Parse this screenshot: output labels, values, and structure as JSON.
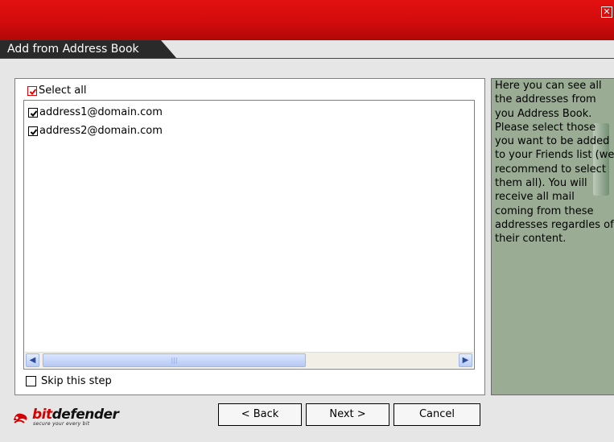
{
  "window": {
    "close_glyph": "✕"
  },
  "header": {
    "title": "Add from Address Book"
  },
  "select_all": {
    "label": "Select all",
    "checked": true
  },
  "address_list": [
    {
      "email": "address1@domain.com",
      "checked": true
    },
    {
      "email": "address2@domain.com",
      "checked": true
    }
  ],
  "scrollbar": {
    "left_arrow": "◀",
    "right_arrow": "▶",
    "thumb_grip": "|||"
  },
  "skip": {
    "label": "Skip this step",
    "checked": false
  },
  "help": {
    "text": "Here you can see all the addresses from you Address Book. Please select those you want to be added to your Friends list (we recommend to select them all). You will receive all mail coming from these addresses regardles of their content."
  },
  "logo": {
    "text_bit": "bit",
    "text_defender": "defender",
    "tagline": "secure your every bit"
  },
  "buttons": {
    "back": "< Back",
    "next": "Next >",
    "cancel": "Cancel"
  },
  "colors": {
    "titlebar": "#d20b0b",
    "header_strip": "#2a2a2a",
    "check_accent": "#e00000",
    "help_panel": "#9aac94"
  }
}
